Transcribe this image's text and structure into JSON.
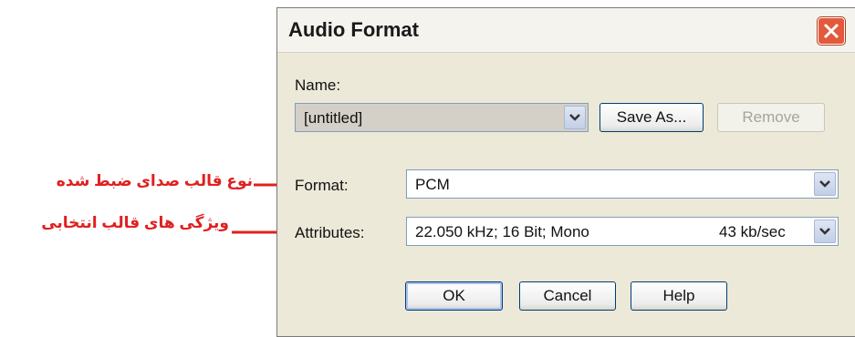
{
  "dialog": {
    "title": "Audio Format",
    "name_label": "Name:",
    "name_value": "[untitled]",
    "save_as": "Save As...",
    "remove": "Remove",
    "format_label": "Format:",
    "format_value": "PCM",
    "attributes_label": "Attributes:",
    "attributes_value": "22.050 kHz; 16 Bit; Mono",
    "attributes_rate": "43 kb/sec",
    "ok": "OK",
    "cancel": "Cancel",
    "help": "Help"
  },
  "annotations": {
    "format_note": "نوع قالب صدای ضبط شده",
    "attributes_note": "ویژگی های قالب انتخابی"
  },
  "icons": {
    "close": "close-icon",
    "dropdown": "chevron-down-icon",
    "arrow": "arrow-right-icon"
  },
  "colors": {
    "annotation": "#e02020",
    "close_button": "#e3593b",
    "dialog_bg": "#ece9d8"
  }
}
